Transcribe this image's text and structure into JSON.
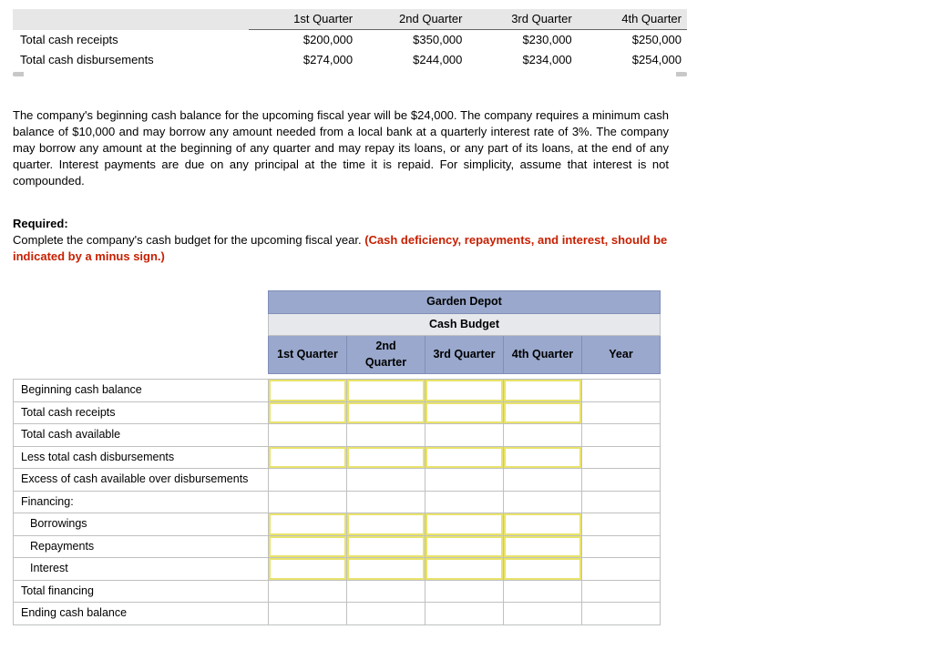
{
  "top_table": {
    "headers": [
      "1st Quarter",
      "2nd Quarter",
      "3rd Quarter",
      "4th Quarter"
    ],
    "rows": [
      {
        "label": "Total cash receipts",
        "values": [
          "$200,000",
          "$350,000",
          "$230,000",
          "$250,000"
        ]
      },
      {
        "label": "Total cash disbursements",
        "values": [
          "$274,000",
          "$244,000",
          "$234,000",
          "$254,000"
        ]
      }
    ]
  },
  "paragraph": "The company's beginning cash balance for the upcoming fiscal year will be $24,000. The company requires a minimum cash balance of $10,000 and may borrow any amount needed from a local bank at a quarterly interest rate of 3%. The company may borrow any amount at the beginning of any quarter and may repay its loans, or any part of its loans, at the end of any quarter. Interest payments are due on any principal at the time it is repaid. For simplicity, assume that interest is not compounded.",
  "required": {
    "label": "Required:",
    "text_plain": "Complete the company's cash budget for the upcoming fiscal year. ",
    "text_red": "(Cash deficiency, repayments, and interest, should be indicated by a minus sign.)"
  },
  "budget": {
    "company": "Garden Depot",
    "title": "Cash Budget",
    "col_headers": [
      "1st Quarter",
      "2nd Quarter",
      "3rd Quarter",
      "4th Quarter",
      "Year"
    ],
    "rows": [
      {
        "label": "Beginning cash balance",
        "editable": [
          true,
          true,
          true,
          true,
          false
        ],
        "indent": 0
      },
      {
        "label": "Total cash receipts",
        "editable": [
          true,
          true,
          true,
          true,
          false
        ],
        "indent": 0
      },
      {
        "label": "Total cash available",
        "editable": [
          false,
          false,
          false,
          false,
          false
        ],
        "indent": 0
      },
      {
        "label": "Less total cash disbursements",
        "editable": [
          true,
          true,
          true,
          true,
          false
        ],
        "indent": 0
      },
      {
        "label": "Excess of cash available over disbursements",
        "editable": [
          false,
          false,
          false,
          false,
          false
        ],
        "indent": 0
      },
      {
        "label": "Financing:",
        "editable": null,
        "indent": 0
      },
      {
        "label": "Borrowings",
        "editable": [
          true,
          true,
          true,
          true,
          false
        ],
        "indent": 1
      },
      {
        "label": "Repayments",
        "editable": [
          true,
          true,
          true,
          true,
          false
        ],
        "indent": 1
      },
      {
        "label": "Interest",
        "editable": [
          true,
          true,
          true,
          true,
          false
        ],
        "indent": 1
      },
      {
        "label": "Total financing",
        "editable": [
          false,
          false,
          false,
          false,
          false
        ],
        "indent": 0
      },
      {
        "label": "Ending cash balance",
        "editable": [
          false,
          false,
          false,
          false,
          false
        ],
        "indent": 0
      }
    ]
  }
}
